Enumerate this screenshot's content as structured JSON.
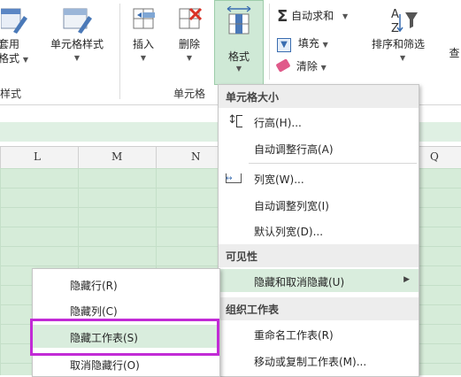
{
  "ribbon": {
    "table_format_top": "套用",
    "table_format_bottom": "格式",
    "cell_styles": "单元格样式",
    "styles_group": "样式",
    "insert": "插入",
    "delete": "删除",
    "format": "格式",
    "cells_group": "单元格",
    "autosum": "自动求和",
    "fill": "填充",
    "clear": "清除",
    "sort_filter": "排序和筛选",
    "find_partial": "查"
  },
  "columns": [
    "L",
    "M",
    "N",
    "Q"
  ],
  "format_menu": {
    "header_cell_size": "单元格大小",
    "row_height": "行高(H)...",
    "autofit_row": "自动调整行高(A)",
    "column_width": "列宽(W)...",
    "autofit_column": "自动调整列宽(I)",
    "default_width": "默认列宽(D)...",
    "header_visibility": "可见性",
    "hide_unhide": "隐藏和取消隐藏(U)",
    "header_organize": "组织工作表",
    "rename_sheet": "重命名工作表(R)",
    "move_copy_sheet": "移动或复制工作表(M)..."
  },
  "submenu": {
    "hide_rows": "隐藏行(R)",
    "hide_columns": "隐藏列(C)",
    "hide_sheet": "隐藏工作表(S)",
    "unhide_rows": "取消隐藏行(O)"
  },
  "colors": {
    "accent_green": "#cfe9d6",
    "highlight_border": "#c22bd6",
    "grid_green": "#d6ecd9"
  }
}
